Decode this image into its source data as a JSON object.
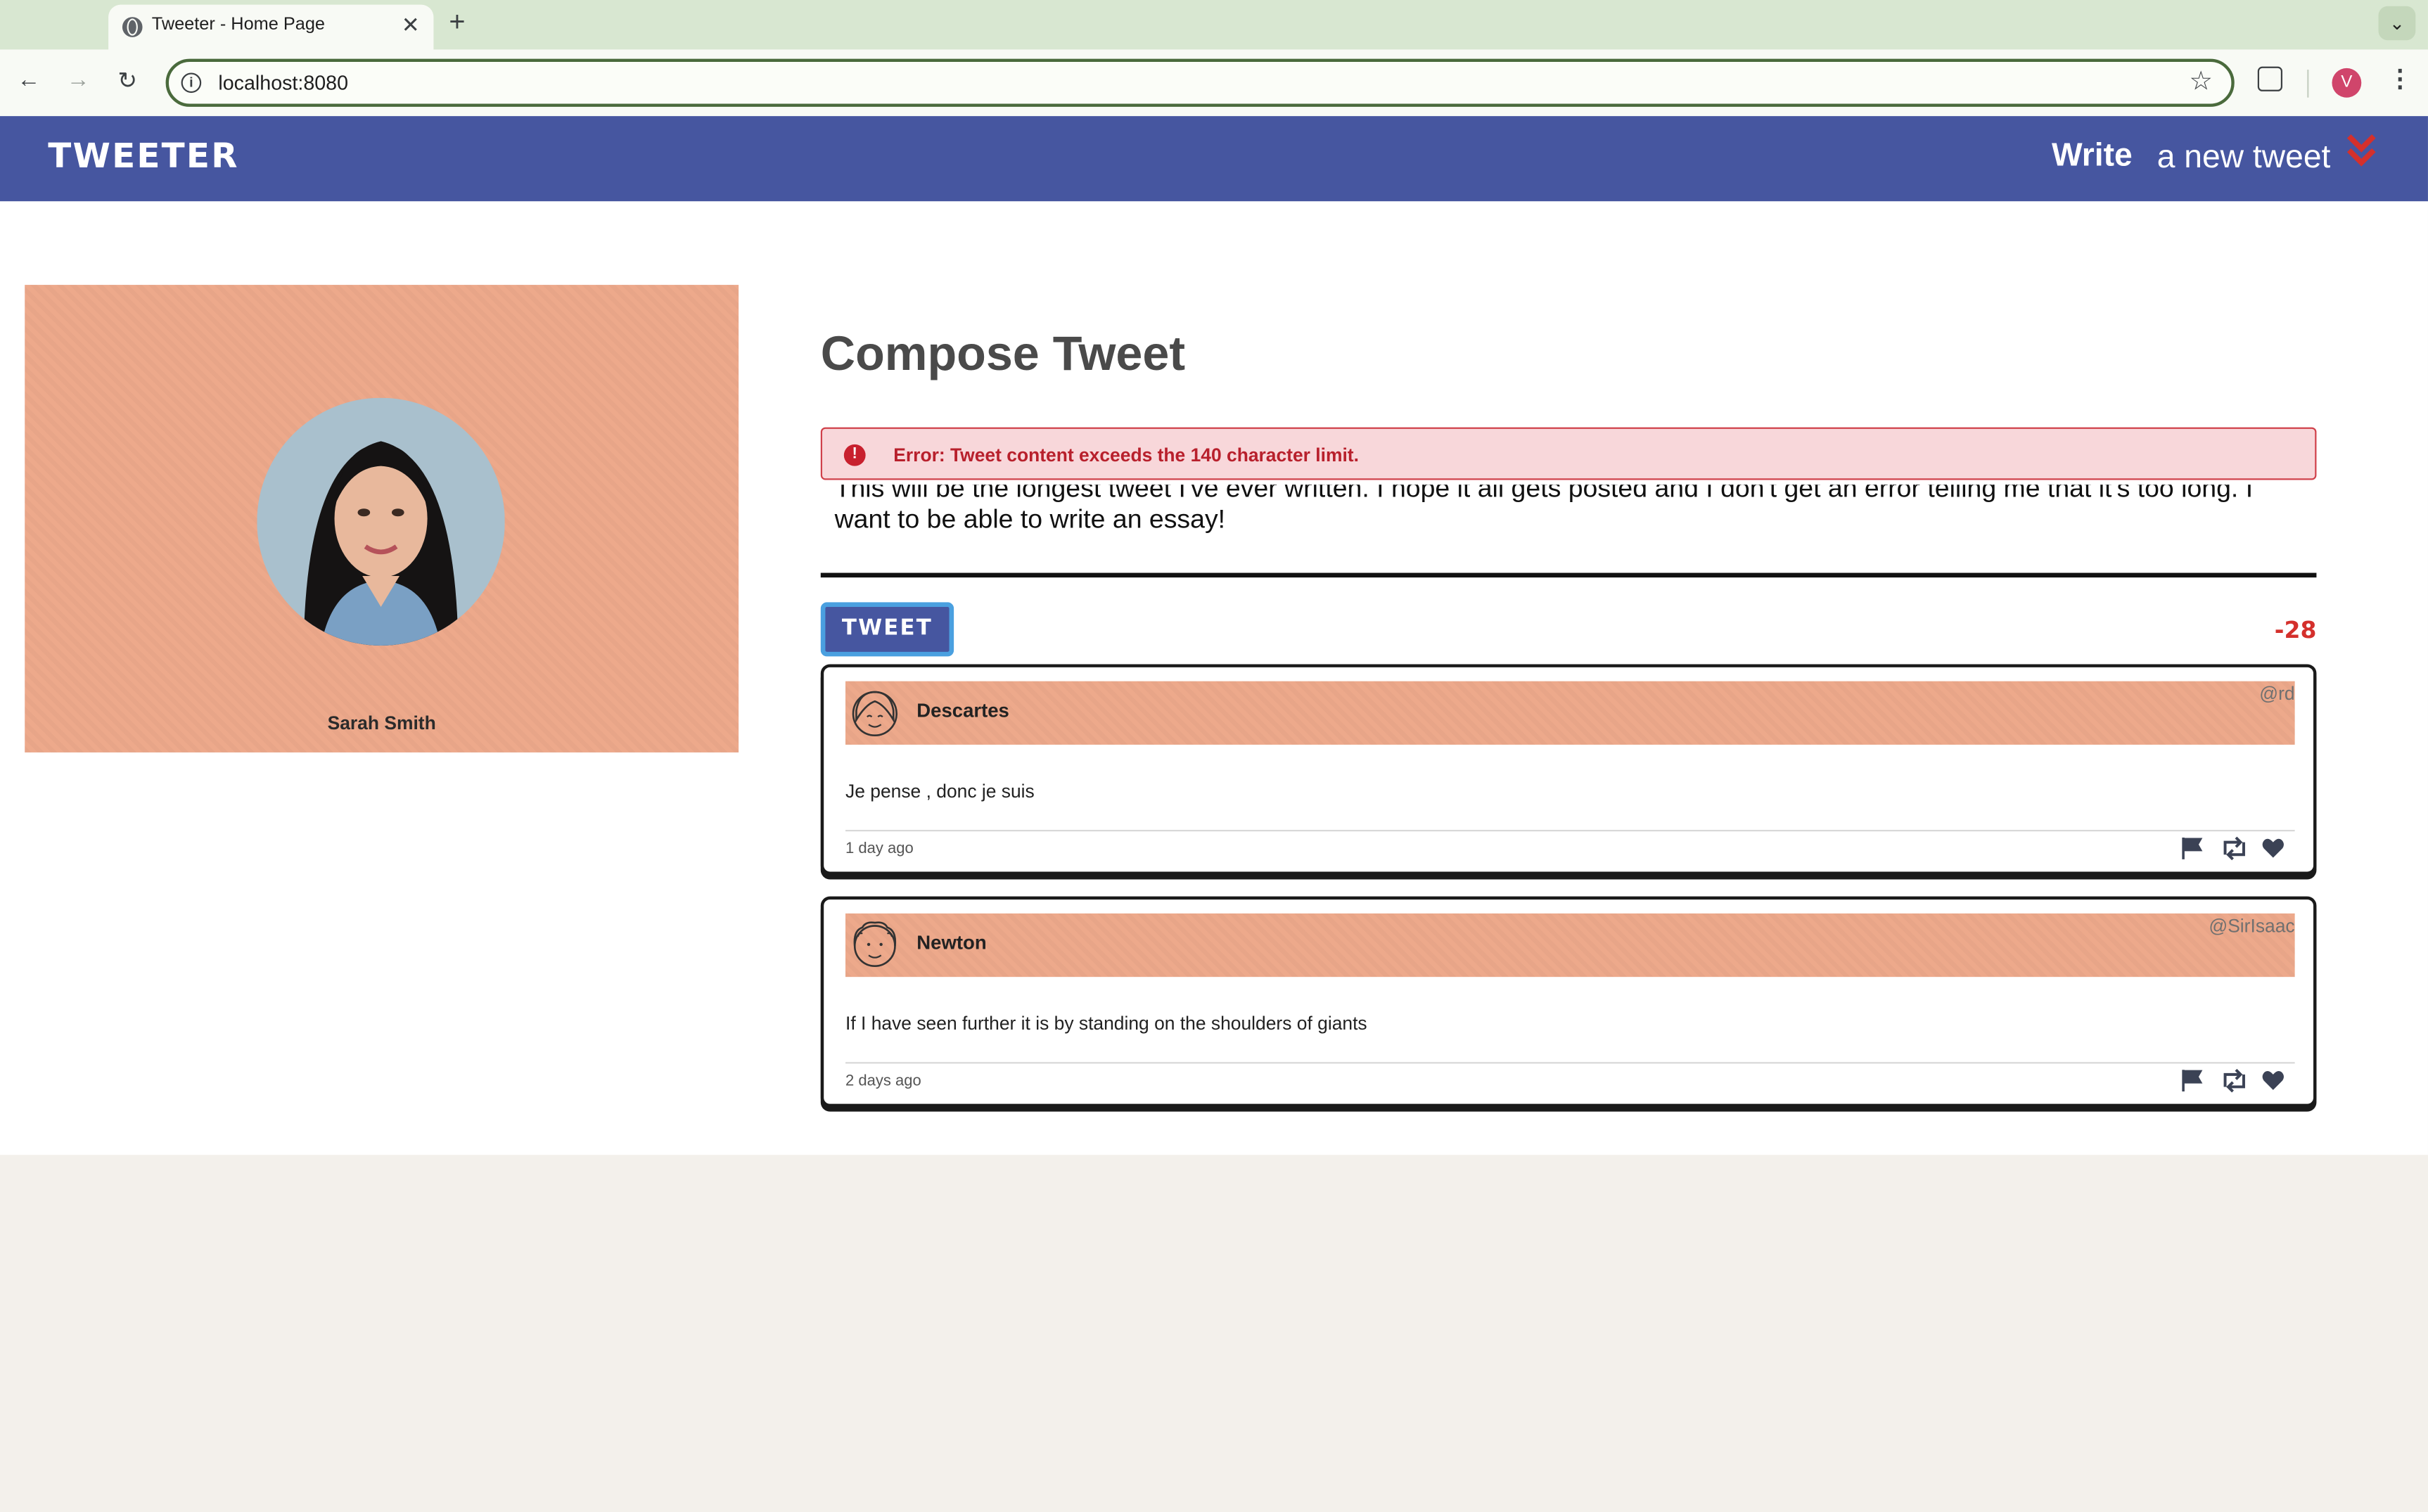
{
  "browser": {
    "tab_title": "Tweeter - Home Page",
    "tab_close": "✕",
    "new_tab": "+",
    "url": "localhost:8080",
    "profile_initial": "V"
  },
  "navbar": {
    "brand": "TWEETER",
    "write_bold": "Write",
    "write_rest": "a new tweet"
  },
  "profile": {
    "name": "Sarah Smith"
  },
  "compose": {
    "title": "Compose Tweet",
    "error": "Error: Tweet content exceeds the 140 character limit.",
    "text_line1": "This will be the longest tweet I've ever written. I hope it all gets posted and I don't get an error telling me that it's too long. I",
    "text_line2": "want to be able to write an essay!",
    "button": "TWEET",
    "counter": "-28"
  },
  "tweets": [
    {
      "author": "Descartes",
      "handle": "@rd",
      "content": "Je pense , donc je suis",
      "time": "1 day ago"
    },
    {
      "author": "Newton",
      "handle": "@SirIsaac",
      "content": "If I have seen further it is by standing on the shoulders of giants",
      "time": "2 days ago"
    }
  ],
  "colors": {
    "navbar": "#4656a0",
    "accent_peach": "#eda98b",
    "error_text": "#b8202c",
    "counter": "#d4302c"
  }
}
